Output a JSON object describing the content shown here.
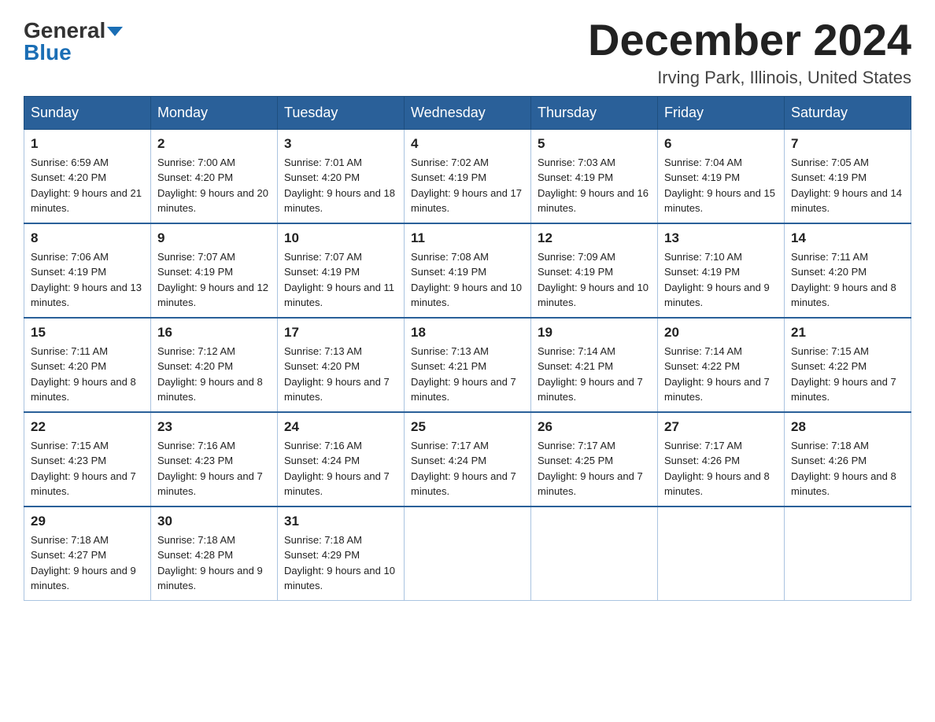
{
  "header": {
    "logo_general": "General",
    "logo_blue": "Blue",
    "month_title": "December 2024",
    "location": "Irving Park, Illinois, United States"
  },
  "days_of_week": [
    "Sunday",
    "Monday",
    "Tuesday",
    "Wednesday",
    "Thursday",
    "Friday",
    "Saturday"
  ],
  "weeks": [
    [
      {
        "day": "1",
        "sunrise": "6:59 AM",
        "sunset": "4:20 PM",
        "daylight": "9 hours and 21 minutes."
      },
      {
        "day": "2",
        "sunrise": "7:00 AM",
        "sunset": "4:20 PM",
        "daylight": "9 hours and 20 minutes."
      },
      {
        "day": "3",
        "sunrise": "7:01 AM",
        "sunset": "4:20 PM",
        "daylight": "9 hours and 18 minutes."
      },
      {
        "day": "4",
        "sunrise": "7:02 AM",
        "sunset": "4:19 PM",
        "daylight": "9 hours and 17 minutes."
      },
      {
        "day": "5",
        "sunrise": "7:03 AM",
        "sunset": "4:19 PM",
        "daylight": "9 hours and 16 minutes."
      },
      {
        "day": "6",
        "sunrise": "7:04 AM",
        "sunset": "4:19 PM",
        "daylight": "9 hours and 15 minutes."
      },
      {
        "day": "7",
        "sunrise": "7:05 AM",
        "sunset": "4:19 PM",
        "daylight": "9 hours and 14 minutes."
      }
    ],
    [
      {
        "day": "8",
        "sunrise": "7:06 AM",
        "sunset": "4:19 PM",
        "daylight": "9 hours and 13 minutes."
      },
      {
        "day": "9",
        "sunrise": "7:07 AM",
        "sunset": "4:19 PM",
        "daylight": "9 hours and 12 minutes."
      },
      {
        "day": "10",
        "sunrise": "7:07 AM",
        "sunset": "4:19 PM",
        "daylight": "9 hours and 11 minutes."
      },
      {
        "day": "11",
        "sunrise": "7:08 AM",
        "sunset": "4:19 PM",
        "daylight": "9 hours and 10 minutes."
      },
      {
        "day": "12",
        "sunrise": "7:09 AM",
        "sunset": "4:19 PM",
        "daylight": "9 hours and 10 minutes."
      },
      {
        "day": "13",
        "sunrise": "7:10 AM",
        "sunset": "4:19 PM",
        "daylight": "9 hours and 9 minutes."
      },
      {
        "day": "14",
        "sunrise": "7:11 AM",
        "sunset": "4:20 PM",
        "daylight": "9 hours and 8 minutes."
      }
    ],
    [
      {
        "day": "15",
        "sunrise": "7:11 AM",
        "sunset": "4:20 PM",
        "daylight": "9 hours and 8 minutes."
      },
      {
        "day": "16",
        "sunrise": "7:12 AM",
        "sunset": "4:20 PM",
        "daylight": "9 hours and 8 minutes."
      },
      {
        "day": "17",
        "sunrise": "7:13 AM",
        "sunset": "4:20 PM",
        "daylight": "9 hours and 7 minutes."
      },
      {
        "day": "18",
        "sunrise": "7:13 AM",
        "sunset": "4:21 PM",
        "daylight": "9 hours and 7 minutes."
      },
      {
        "day": "19",
        "sunrise": "7:14 AM",
        "sunset": "4:21 PM",
        "daylight": "9 hours and 7 minutes."
      },
      {
        "day": "20",
        "sunrise": "7:14 AM",
        "sunset": "4:22 PM",
        "daylight": "9 hours and 7 minutes."
      },
      {
        "day": "21",
        "sunrise": "7:15 AM",
        "sunset": "4:22 PM",
        "daylight": "9 hours and 7 minutes."
      }
    ],
    [
      {
        "day": "22",
        "sunrise": "7:15 AM",
        "sunset": "4:23 PM",
        "daylight": "9 hours and 7 minutes."
      },
      {
        "day": "23",
        "sunrise": "7:16 AM",
        "sunset": "4:23 PM",
        "daylight": "9 hours and 7 minutes."
      },
      {
        "day": "24",
        "sunrise": "7:16 AM",
        "sunset": "4:24 PM",
        "daylight": "9 hours and 7 minutes."
      },
      {
        "day": "25",
        "sunrise": "7:17 AM",
        "sunset": "4:24 PM",
        "daylight": "9 hours and 7 minutes."
      },
      {
        "day": "26",
        "sunrise": "7:17 AM",
        "sunset": "4:25 PM",
        "daylight": "9 hours and 7 minutes."
      },
      {
        "day": "27",
        "sunrise": "7:17 AM",
        "sunset": "4:26 PM",
        "daylight": "9 hours and 8 minutes."
      },
      {
        "day": "28",
        "sunrise": "7:18 AM",
        "sunset": "4:26 PM",
        "daylight": "9 hours and 8 minutes."
      }
    ],
    [
      {
        "day": "29",
        "sunrise": "7:18 AM",
        "sunset": "4:27 PM",
        "daylight": "9 hours and 9 minutes."
      },
      {
        "day": "30",
        "sunrise": "7:18 AM",
        "sunset": "4:28 PM",
        "daylight": "9 hours and 9 minutes."
      },
      {
        "day": "31",
        "sunrise": "7:18 AM",
        "sunset": "4:29 PM",
        "daylight": "9 hours and 10 minutes."
      },
      null,
      null,
      null,
      null
    ]
  ]
}
